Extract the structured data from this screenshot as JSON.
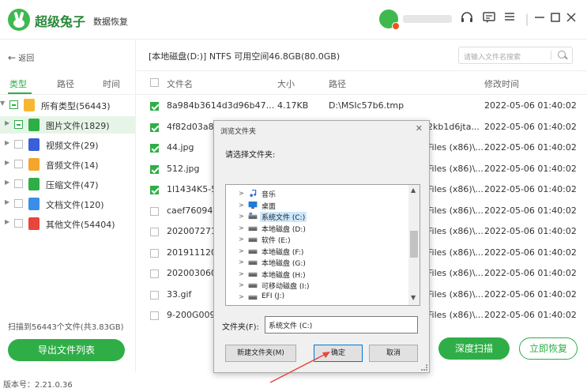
{
  "app": {
    "name": "超级兔子",
    "subtitle": "数据恢复",
    "version_label": "版本号：2.21.0.36"
  },
  "titlebar_icons": [
    "headset-icon",
    "chat-icon",
    "menu-icon",
    "minimize-icon",
    "maximize-icon",
    "close-icon"
  ],
  "sidebar": {
    "back_label": "返回",
    "tabs": [
      {
        "label": "类型",
        "active": true
      },
      {
        "label": "路径",
        "active": false
      },
      {
        "label": "时间",
        "active": false
      }
    ],
    "tree": [
      {
        "label": "所有类型(56443)",
        "icon": "folder-icon",
        "color": "#f7b733",
        "level": 0,
        "expanded": true
      },
      {
        "label": "图片文件(1829)",
        "icon": "image-file-icon",
        "color": "#2fae47",
        "level": 1,
        "selected": true
      },
      {
        "label": "视频文件(29)",
        "icon": "video-file-icon",
        "color": "#3a5fd9",
        "level": 1
      },
      {
        "label": "音频文件(14)",
        "icon": "audio-file-icon",
        "color": "#f4a52b",
        "level": 1
      },
      {
        "label": "压缩文件(47)",
        "icon": "archive-file-icon",
        "color": "#2fae47",
        "level": 1
      },
      {
        "label": "文档文件(120)",
        "icon": "document-file-icon",
        "color": "#3a8ee8",
        "level": 1
      },
      {
        "label": "其他文件(54404)",
        "icon": "other-file-icon",
        "color": "#e8453c",
        "level": 1
      }
    ],
    "scan_info": "扫描到56443个文件(共3.83GB)",
    "export_label": "导出文件列表"
  },
  "main": {
    "path": "[本地磁盘(D:)] NTFS 可用空间46.8GB(80.0GB)",
    "search_placeholder": "请输入文件名搜索",
    "columns": {
      "name": "文件名",
      "size": "大小",
      "path": "路径",
      "modified": "修改时间"
    },
    "rows": [
      {
        "checked": true,
        "name": "8a984b3614d3d96b47...",
        "size": "4.17KB",
        "path": "D:\\MSIc57b6.tmp",
        "modified": "2022-05-06 01:40:02"
      },
      {
        "checked": true,
        "name": "4f82d03a82",
        "size": "",
        "path": "2kb1d6jta...",
        "modified": "2022-05-06 01:40:02"
      },
      {
        "checked": true,
        "name": "44.jpg",
        "size": "",
        "path": "Files (x86)\\...",
        "modified": "2022-05-06 01:40:02"
      },
      {
        "checked": true,
        "name": "512.jpg",
        "size": "",
        "path": "Files (x86)\\...",
        "modified": "2022-05-06 01:40:02"
      },
      {
        "checked": true,
        "name": "1l1434K5-5.",
        "size": "",
        "path": "Files (x86)\\...",
        "modified": "2022-05-06 01:40:02"
      },
      {
        "checked": false,
        "name": "caef76094b",
        "size": "",
        "path": "Files (x86)\\...",
        "modified": "2022-05-06 01:40:02"
      },
      {
        "checked": false,
        "name": "2020072711",
        "size": "",
        "path": "Files (x86)\\...",
        "modified": "2022-05-06 01:40:02"
      },
      {
        "checked": false,
        "name": "2019111204",
        "size": "",
        "path": "Files (x86)\\...",
        "modified": "2022-05-06 01:40:02"
      },
      {
        "checked": false,
        "name": "2020030604",
        "size": "",
        "path": "Files (x86)\\...",
        "modified": "2022-05-06 01:40:02"
      },
      {
        "checked": false,
        "name": "33.gif",
        "size": "",
        "path": "Files (x86)\\...",
        "modified": "2022-05-06 01:40:02"
      },
      {
        "checked": false,
        "name": "9-200G0091",
        "size": "",
        "path": "Files (x86)\\...",
        "modified": "2022-05-06 01:40:02"
      }
    ],
    "deep_scan_label": "深度扫描",
    "restore_label": "立即恢复"
  },
  "dialog": {
    "title": "浏览文件夹",
    "prompt": "请选择文件夹:",
    "tree": [
      {
        "label": "音乐",
        "icon": "music-icon"
      },
      {
        "label": "桌面",
        "icon": "desktop-icon"
      },
      {
        "label": "系统文件 (C:)",
        "icon": "drive-icon",
        "selected": true
      },
      {
        "label": "本地磁盘 (D:)",
        "icon": "drive-icon"
      },
      {
        "label": "软件 (E:)",
        "icon": "drive-icon"
      },
      {
        "label": "本地磁盘 (F:)",
        "icon": "drive-icon"
      },
      {
        "label": "本地磁盘 (G:)",
        "icon": "drive-icon"
      },
      {
        "label": "本地磁盘 (H:)",
        "icon": "drive-icon"
      },
      {
        "label": "可移动磁盘 (I:)",
        "icon": "drive-icon"
      },
      {
        "label": "EFI (J:)",
        "icon": "drive-icon"
      }
    ],
    "folder_label": "文件夹(F):",
    "folder_value": "系统文件 (C:)",
    "new_folder_label": "新建文件夹(M)",
    "ok_label": "确定",
    "cancel_label": "取消"
  },
  "colors": {
    "accent": "#2fae47",
    "annotation": "#e8453c"
  }
}
